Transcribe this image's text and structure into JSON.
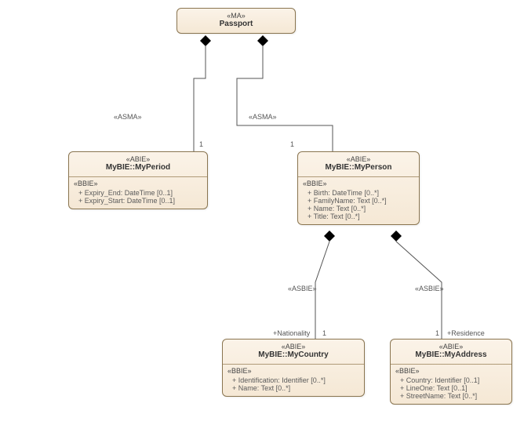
{
  "passport": {
    "stereo": "«MA»",
    "name": "Passport"
  },
  "myperiod": {
    "stereo": "«ABIE»",
    "name": "MyBIE::MyPeriod",
    "compStereo": "«BBIE»",
    "attrs": [
      "+    Expiry_End: DateTime [0..1]",
      "+    Expiry_Start: DateTime [0..1]"
    ]
  },
  "myperson": {
    "stereo": "«ABIE»",
    "name": "MyBIE::MyPerson",
    "compStereo": "«BBIE»",
    "attrs": [
      "+    Birth: DateTime [0..*]",
      "+    FamilyName: Text [0..*]",
      "+    Name: Text [0..*]",
      "+    Title: Text [0..*]"
    ]
  },
  "mycountry": {
    "stereo": "«ABIE»",
    "name": "MyBIE::MyCountry",
    "compStereo": "«BBIE»",
    "attrs": [
      "+    Identification: Identifier [0..*]",
      "+    Name: Text [0..*]"
    ]
  },
  "myaddress": {
    "stereo": "«ABIE»",
    "name": "MyBIE::MyAddress",
    "compStereo": "«BBIE»",
    "attrs": [
      "+    Country: Identifier [0..1]",
      "+    LineOne: Text [0..1]",
      "+    StreetName: Text [0..*]"
    ]
  },
  "labels": {
    "asma1": "«ASMA»",
    "asma2": "«ASMA»",
    "one1": "1",
    "one2": "1",
    "asbie1": "«ASBIE»",
    "asbie2": "«ASBIE»",
    "nationality": "+Nationality",
    "residence": "+Residence",
    "one3": "1",
    "one4": "1"
  }
}
